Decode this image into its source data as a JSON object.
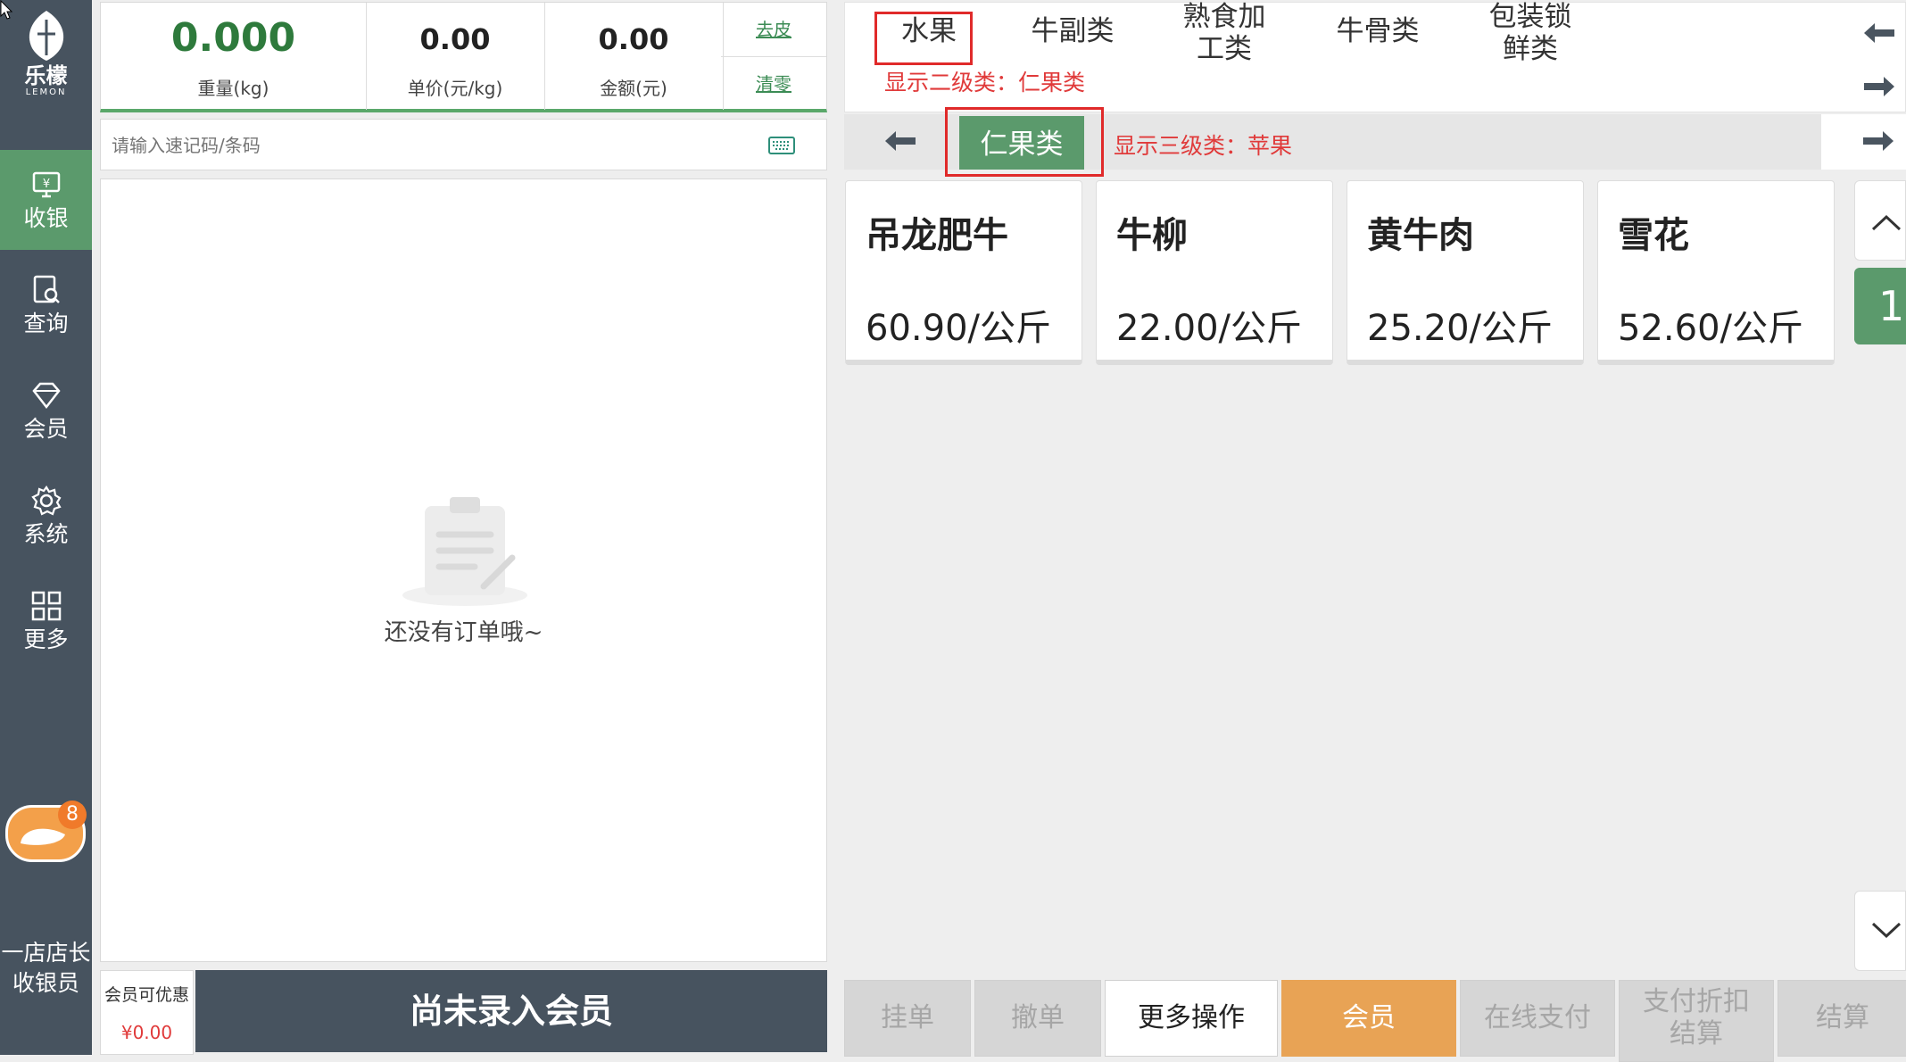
{
  "sidebar": {
    "brand": "乐檬",
    "brand_sub": "LEMON",
    "items": [
      {
        "label": "收银",
        "icon": "cashier-icon"
      },
      {
        "label": "查询",
        "icon": "search-doc-icon"
      },
      {
        "label": "会员",
        "icon": "diamond-icon"
      },
      {
        "label": "系统",
        "icon": "gear-icon"
      },
      {
        "label": "更多",
        "icon": "grid-icon"
      }
    ],
    "badge": "8",
    "user_store": "一店店长",
    "user_role": "收银员"
  },
  "scale": {
    "weight": "0.000",
    "weight_label": "重量(kg)",
    "price": "0.00",
    "price_label": "单价(元/kg)",
    "amount": "0.00",
    "amount_label": "金额(元)",
    "tare": "去皮",
    "zero": "清零"
  },
  "search": {
    "placeholder": "请输入速记码/条码"
  },
  "orders": {
    "empty": "还没有订单哦~"
  },
  "member": {
    "discount_label": "会员可优惠",
    "discount_value": "¥0.00",
    "bar": "尚未录入会员"
  },
  "categories": {
    "level1": [
      "水果",
      "牛副类",
      "熟食加",
      "工类",
      "牛骨类",
      "包装锁",
      "鲜类"
    ],
    "level2_hint": "显示二级类：仁果类",
    "level2_selected": "仁果类",
    "level3_hint": "显示三级类：苹果"
  },
  "products": [
    {
      "name": "吊龙肥牛",
      "price": "60.90/公斤"
    },
    {
      "name": "牛柳",
      "price": "22.00/公斤"
    },
    {
      "name": "黄牛肉",
      "price": "25.20/公斤"
    },
    {
      "name": "雪花",
      "price": "52.60/公斤"
    }
  ],
  "pager": {
    "page": "1"
  },
  "actions": {
    "hold": "挂单",
    "cancel": "撤单",
    "more": "更多操作",
    "member": "会员",
    "online_pay": "在线支付",
    "pay_discount_1": "支付折扣",
    "pay_discount_2": "结算",
    "checkout": "结算"
  },
  "colors": {
    "sidebar": "#47535f",
    "active": "#5b9a6c",
    "weight": "#2e7a3c",
    "member_btn": "#e8a355",
    "red": "#e03a3a"
  }
}
